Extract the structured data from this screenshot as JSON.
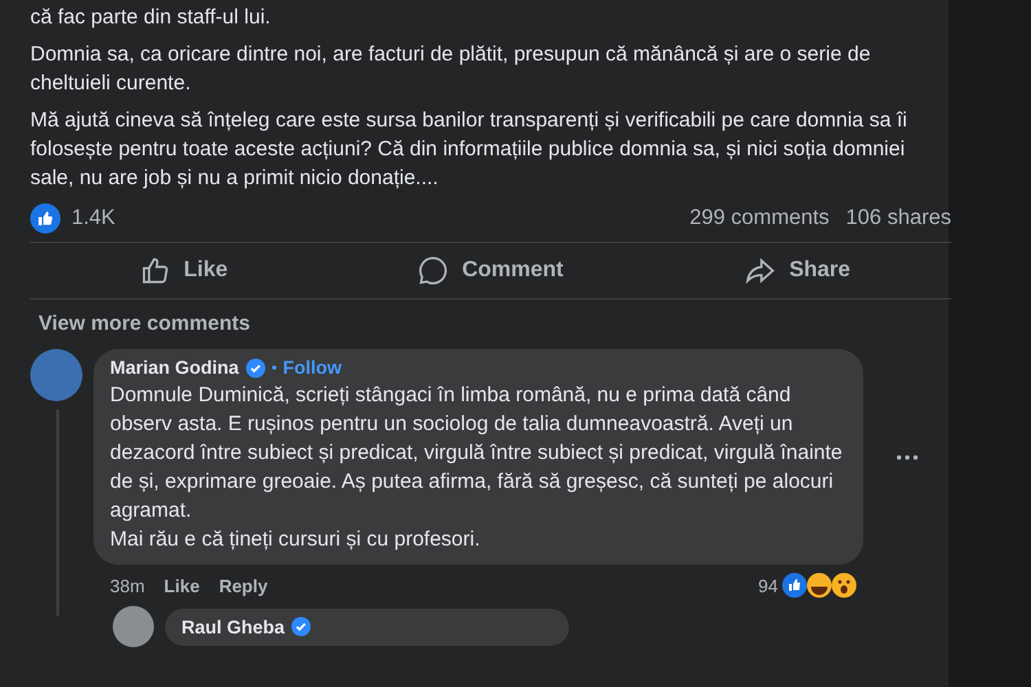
{
  "post": {
    "paragraphs": [
      "că fac parte din staff-ul lui.",
      "Domnia sa, ca oricare dintre noi, are facturi de plătit, presupun că mănâncă și are o serie de cheltuieli curente.",
      "Mă ajută cineva să înțeleg care este sursa banilor transparenți și verificabili pe care domnia sa îi folosește pentru toate aceste acțiuni? Că din informațiile publice domnia sa, și nici soția domniei sale,  nu are job și nu a primit nicio donație...."
    ],
    "reaction_count": "1.4K",
    "comments_count": "299 comments",
    "shares_count": "106 shares",
    "actions": [
      {
        "kind": "like",
        "label": "Like"
      },
      {
        "kind": "comment",
        "label": "Comment"
      },
      {
        "kind": "share",
        "label": "Share"
      }
    ]
  },
  "view_more": "View more comments",
  "comment": {
    "author": "Marian Godina",
    "verified": true,
    "follow": "Follow",
    "text": "Domnule Duminică, scrieți stângaci în limba română, nu e prima dată când observ asta. E rușinos pentru un sociolog de talia dumneavoastră. Aveți un dezacord între subiect și predicat, virgulă între subiect și predicat, virgulă înainte de și, exprimare greoaie. Aș putea afirma, fără să greșesc, că sunteți pe alocuri agramat.\nMai rău e că țineți cursuri și cu profesori.",
    "time": "38m",
    "like": "Like",
    "reply": "Reply",
    "reactions_count": "94"
  },
  "reply": {
    "author": "Raul Gheba",
    "verified": true
  }
}
